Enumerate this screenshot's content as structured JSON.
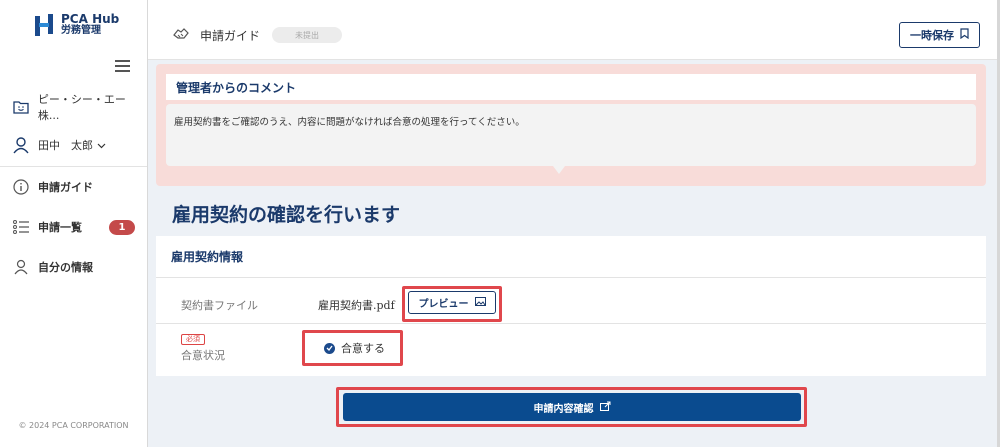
{
  "app": {
    "title": "PCA Hub",
    "subtitle": "労務管理"
  },
  "sidebar": {
    "company": "ピー・シー・エー株...",
    "user": "田中　太郎",
    "items": [
      {
        "label": "申請ガイド"
      },
      {
        "label": "申請一覧",
        "badge": "1"
      },
      {
        "label": "自分の情報"
      }
    ],
    "copyright": "© 2024 PCA CORPORATION"
  },
  "header": {
    "title": "申請ガイド",
    "status": "未提出",
    "save_label": "一時保存"
  },
  "comment": {
    "heading": "管理者からのコメント",
    "body": "雇用契約書をご確認のうえ、内容に問題がなければ合意の処理を行ってください。"
  },
  "main": {
    "section_title": "雇用契約の確認を行います",
    "card_title": "雇用契約情報",
    "rows": {
      "file_label": "契約書ファイル",
      "file_name": "雇用契約書.pdf",
      "preview_label": "プレビュー",
      "required_tag": "必須",
      "agree_label": "合意状況",
      "agree_value": "合意する"
    },
    "confirm_label": "申請内容確認"
  },
  "colors": {
    "brand": "#1b3a6b",
    "primary_button": "#0a4b8f",
    "highlight": "#e0474c",
    "badge": "#c44a4a",
    "comment_bg": "#f8dcd9"
  }
}
